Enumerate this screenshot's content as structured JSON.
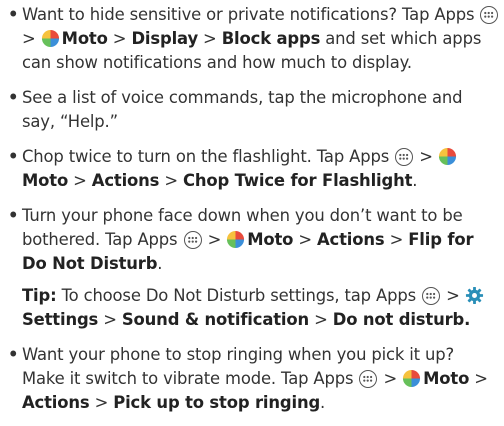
{
  "items": [
    {
      "bullet": "•",
      "t1": "Want to hide sensitive or private notifications? Tap Apps",
      "sep1": ">",
      "moto": "Moto",
      "sep2": ">",
      "display": "Display",
      "sep3": ">",
      "block_apps": "Block apps",
      "t2": "and set which apps can show notifications and how much to display."
    },
    {
      "bullet": "•",
      "t1": "See a list of voice commands, tap the microphone and say, “Help.”"
    },
    {
      "bullet": "•",
      "t1": "Chop twice to turn on the flashlight. Tap Apps",
      "sep1": ">",
      "moto": "Moto",
      "sep2": ">",
      "actions": "Actions",
      "sep3": ">",
      "chop": "Chop Twice for Flashlight",
      "t2": "."
    },
    {
      "bullet": "•",
      "t1": "Turn your phone face down when you don’t want to be bothered. Tap Apps",
      "sep1": ">",
      "moto": "Moto",
      "sep2": ">",
      "actions": "Actions",
      "sep3": ">",
      "flip": "Flip for Do Not Disturb",
      "t2": "."
    },
    {
      "bullet": "•",
      "t1": "Want your phone to stop ringing when you pick it up? Make it switch to vibrate mode. Tap Apps",
      "sep1": ">",
      "moto": "Moto",
      "sep2": ">",
      "actions": "Actions",
      "sep3": ">",
      "pickup": "Pick up to stop ringing",
      "t2": "."
    }
  ],
  "tip": {
    "label": "Tip:",
    "t1": "To choose Do Not Disturb settings, tap Apps",
    "sep1": ">",
    "settings": "Settings",
    "sep2": ">",
    "sound": "Sound & notification",
    "sep3": ">",
    "dnd": "Do not disturb."
  },
  "icons": {
    "apps": "apps-grid-icon",
    "moto": "moto-app-icon",
    "settings": "settings-gear-icon"
  },
  "colors": {
    "text": "#333333",
    "gear": "#2a8fb8",
    "moto_red": "#e94b3c",
    "moto_yellow": "#f6c23e",
    "moto_green": "#67c05a",
    "moto_blue": "#3b8fd9"
  }
}
